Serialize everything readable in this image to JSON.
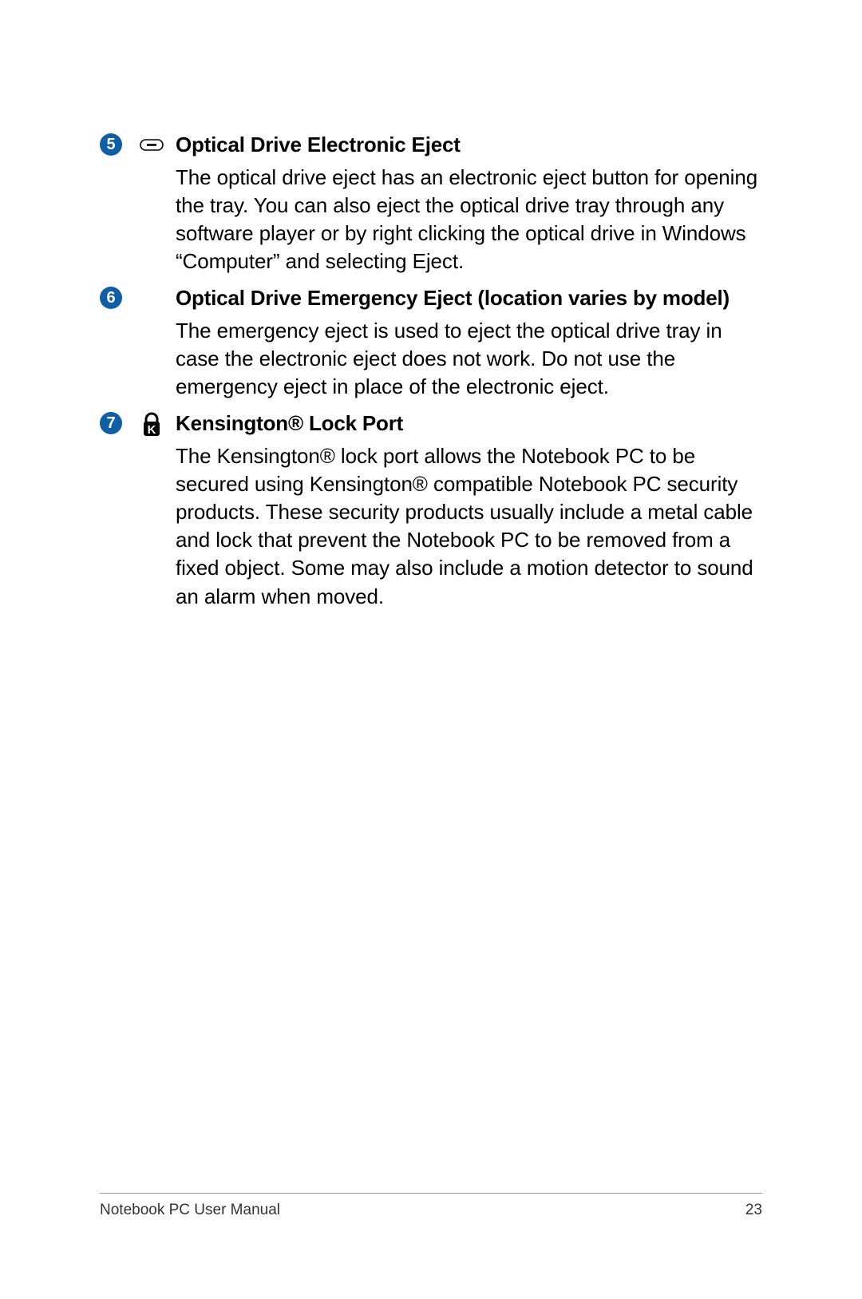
{
  "items": [
    {
      "num": "5",
      "icon": "eject",
      "heading": "Optical Drive Electronic Eject",
      "body": "The optical drive eject has an electronic eject button for opening the tray. You can also eject the optical drive tray through any software player or by right clicking the optical drive in Windows “Computer” and selecting Eject."
    },
    {
      "num": "6",
      "icon": "",
      "heading": "Optical Drive Emergency Eject (location varies by model)",
      "body": "The emergency eject is used to eject the optical drive tray in case the electronic eject does not work. Do not use the emergency eject in place of the electronic eject."
    },
    {
      "num": "7",
      "icon": "lock",
      "heading": "Kensington® Lock Port",
      "body": "The Kensington® lock port allows the Notebook PC to be secured using Kensington® compatible Notebook PC security products. These security products usually include a metal cable and lock that prevent the Notebook PC to be removed from a fixed object. Some may also include a motion detector to sound an alarm when moved."
    }
  ],
  "footer": {
    "title": "Notebook PC User Manual",
    "page": "23"
  },
  "colors": {
    "badge": "#0e5ea8"
  }
}
